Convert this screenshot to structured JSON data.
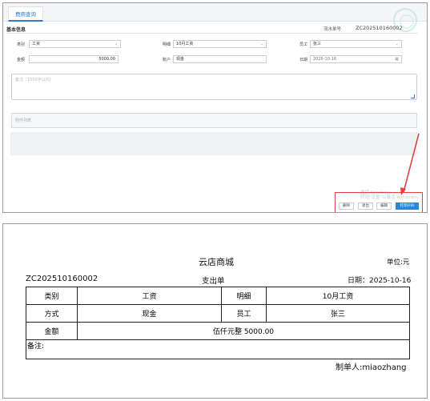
{
  "window": {
    "tab_label": "费用查询",
    "section_title": "基本信息",
    "serial_label": "流水单号",
    "serial_value": "ZC202510160002",
    "form": {
      "category_label": "类别",
      "category_value": "工资",
      "detail_label": "明细",
      "detail_value": "10月工资",
      "employee_label": "员工",
      "employee_value": "张三",
      "amount_label": "金额",
      "amount_value": "5000.00",
      "account_label": "账户",
      "account_value": "现金",
      "date_label": "日期",
      "date_value": "2025-10-16",
      "remark_placeholder": "备注（1000字以内）",
      "attachment_placeholder": "附件列表"
    },
    "watermark": "激活 Windows\n转到\"设置\"以激活 Windows。",
    "buttons": {
      "delete": "删除",
      "close": "退出",
      "edit": "编辑",
      "print": "打印(F8)"
    }
  },
  "print_preview": {
    "store_name": "云店商城",
    "unit": "单位:元",
    "serial": "ZC202510160002",
    "doc_title": "支出单",
    "date_text": "日期：2025-10-16",
    "rows": {
      "category_label": "类别",
      "category_value": "工资",
      "detail_label": "明细",
      "detail_value": "10月工资",
      "method_label": "方式",
      "method_value": "现金",
      "employee_label": "员工",
      "employee_value": "张三",
      "amount_label": "金额",
      "amount_value": "伍仟元整  5000.00",
      "remark_label": "备注:"
    },
    "maker": "制单人:miaozhang"
  },
  "colors": {
    "accent": "#2f86d8",
    "highlight": "#e04040"
  }
}
